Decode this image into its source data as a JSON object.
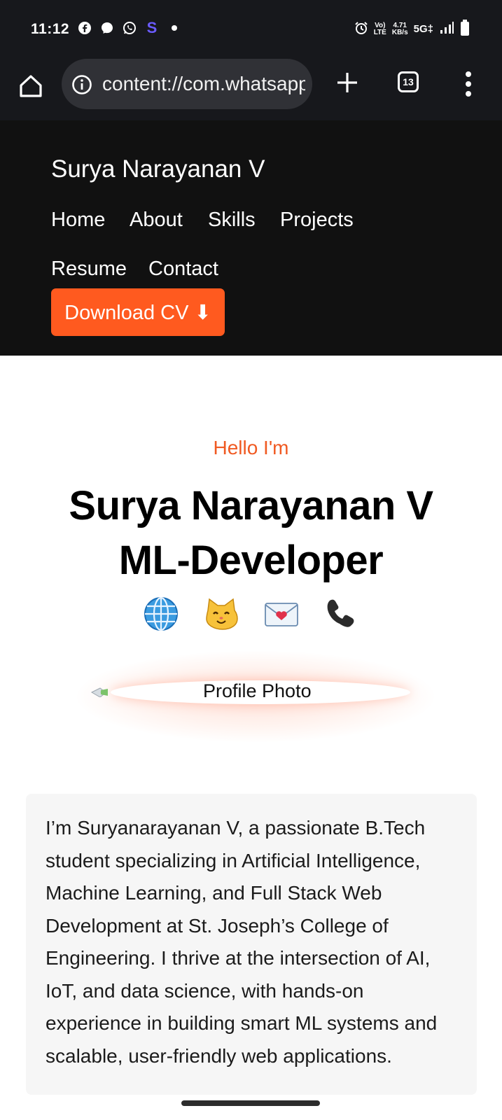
{
  "status_bar": {
    "time": "11:12",
    "left_icons": [
      "facebook-icon",
      "messenger-icon",
      "whatsapp-icon",
      "s-app-icon",
      "dot-icon"
    ],
    "s_app_label": "S",
    "network_label_top": "Vo)",
    "network_label_bottom": "LTE",
    "speed_value": "4.71",
    "speed_unit": "KB/s",
    "signal_label": "5G‡"
  },
  "browser": {
    "url": "content://com.whatsapp",
    "tab_count": "13"
  },
  "header": {
    "brand": "Surya Narayanan V",
    "nav": [
      "Home",
      "About",
      "Skills",
      "Projects",
      "Resume",
      "Contact"
    ],
    "cv_button": "Download CV ⬇"
  },
  "hero": {
    "greeting": "Hello I'm",
    "name": "Surya Narayanan V",
    "role": "ML-Developer",
    "social_icons": [
      "globe-icon",
      "cat-icon",
      "envelope-heart-icon",
      "phone-icon"
    ],
    "social_emoji": [
      "🌐",
      "🐱",
      "💌",
      "📞"
    ],
    "photo_alt": "Profile Photo"
  },
  "about": {
    "text": "I’m Suryanarayanan V, a passionate B.Tech student specializing in Artificial Intelligence, Machine Learning, and Full Stack Web Development at St. Joseph’s College of Engineering. I thrive at the intersection of AI, IoT, and data science, with hands-on experience in building smart ML systems and scalable, user-friendly web applications."
  },
  "colors": {
    "accent": "#ff5a1f",
    "header_bg": "#111111",
    "greeting": "#f05a22"
  }
}
